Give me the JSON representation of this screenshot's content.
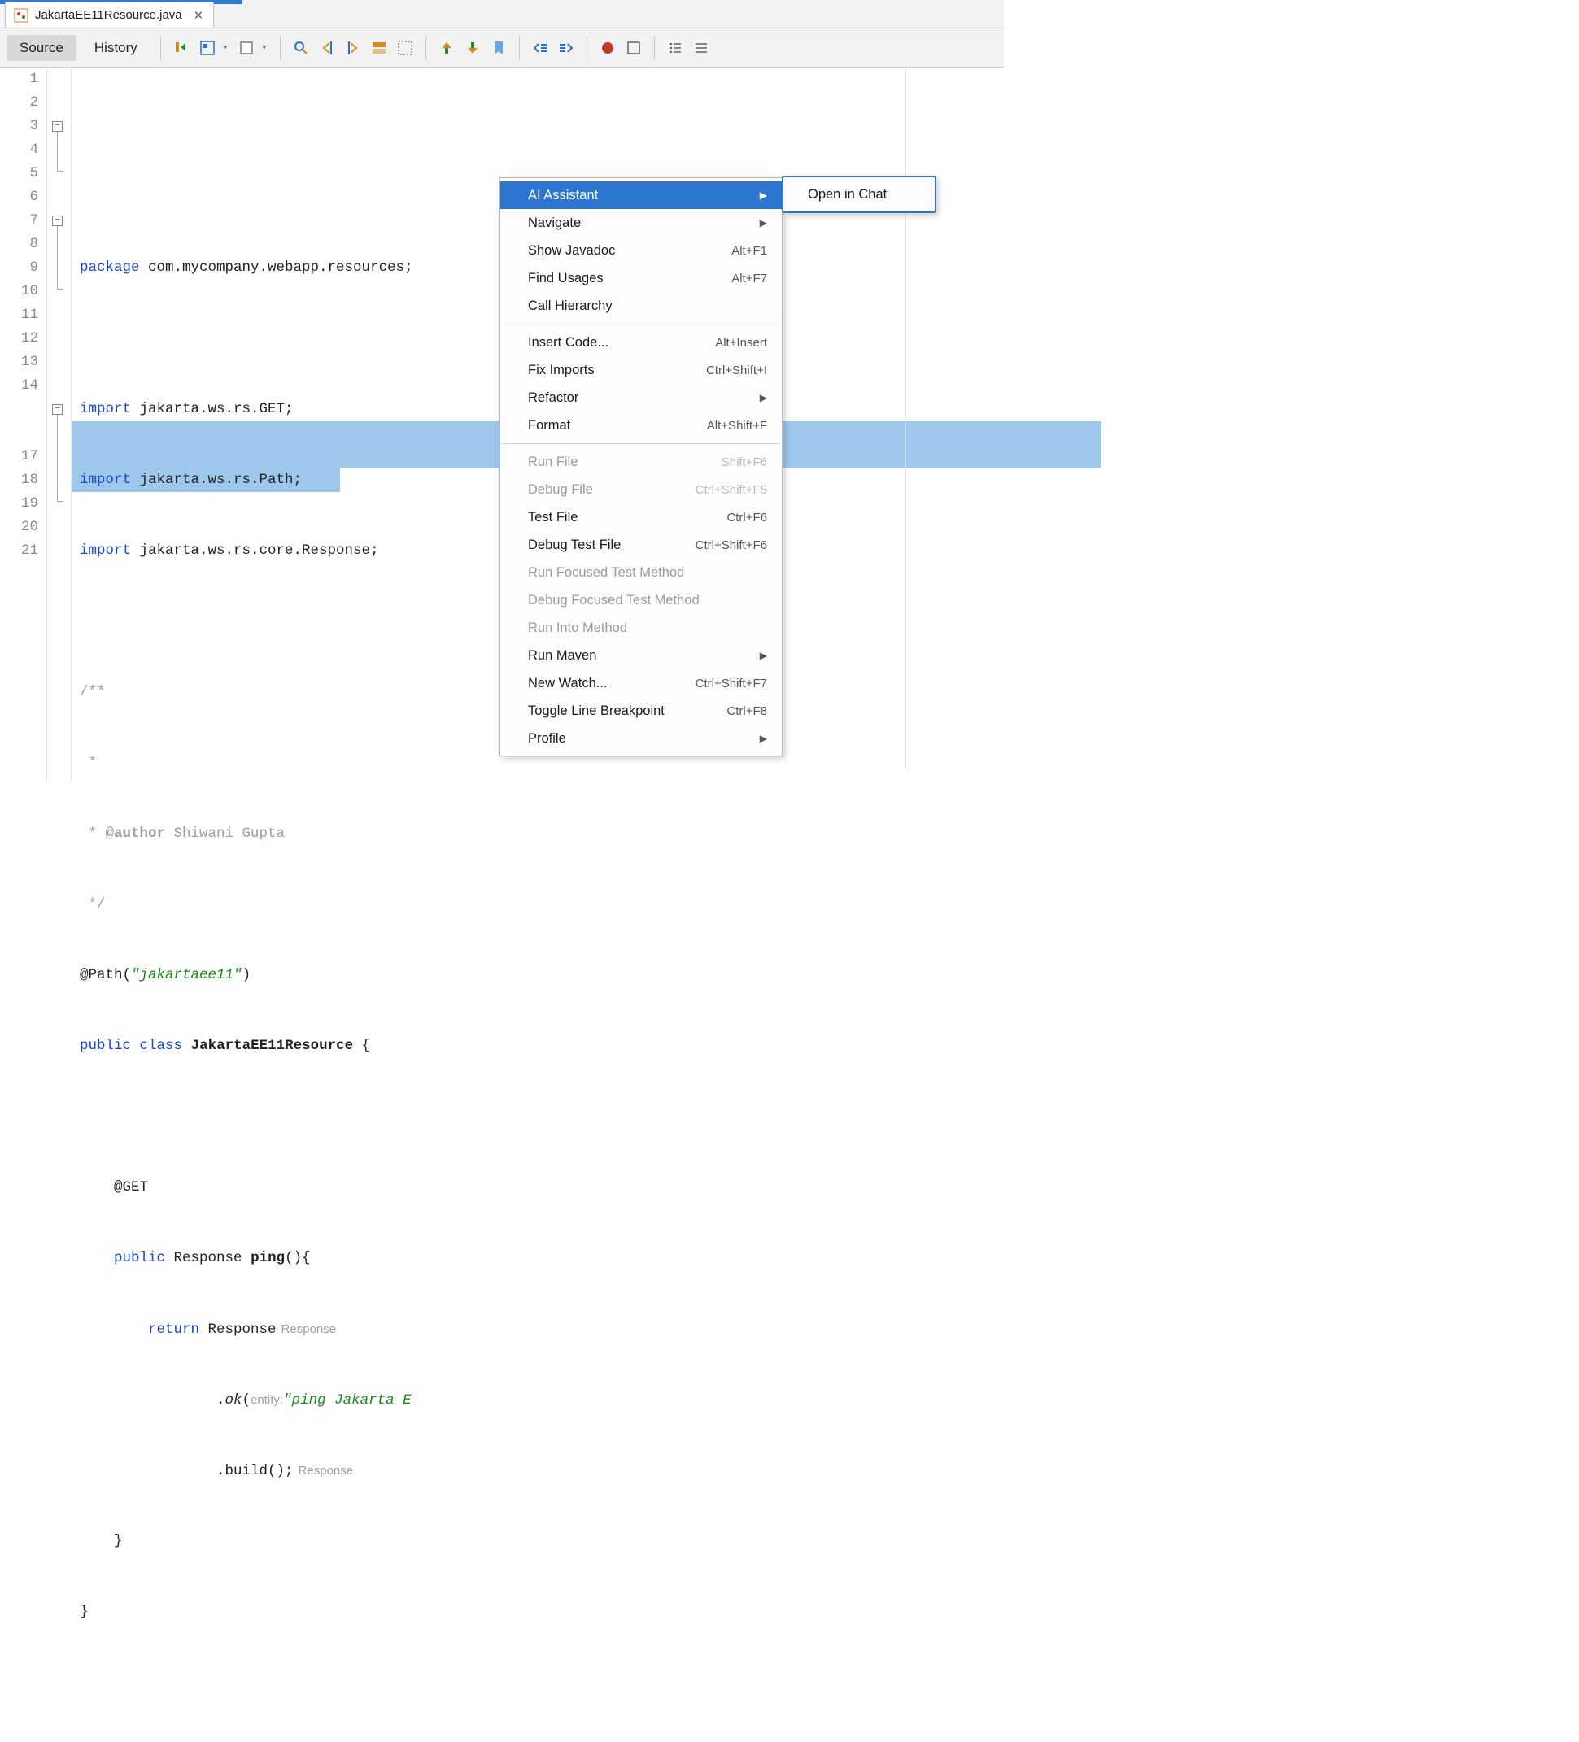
{
  "tab": {
    "filename": "JakartaEE11Resource.java"
  },
  "toolbar": {
    "view_tabs": {
      "source": "Source",
      "history": "History"
    }
  },
  "gutter_lines": [
    "1",
    "2",
    "3",
    "4",
    "5",
    "6",
    "7",
    "8",
    "9",
    "10",
    "11",
    "12",
    "13",
    "14",
    "",
    "",
    "17",
    "18",
    "19",
    "20",
    "21"
  ],
  "code": {
    "l1_kw": "package",
    "l1_rest": " com.mycompany.webapp.resources;",
    "l3_kw": "import",
    "l3_rest": " jakarta.ws.rs.GET;",
    "l4_kw": "import",
    "l4_rest": " jakarta.ws.rs.Path;",
    "l5_kw": "import",
    "l5_rest": " jakarta.ws.rs.core.Response;",
    "l7": "/**",
    "l8": " *",
    "l9_a": " * ",
    "l9_tag": "@author",
    "l9_b": " Shiwani Gupta",
    "l10": " */",
    "l11_a": "@Path",
    "l11_b": "(",
    "l11_str": "\"jakartaee11\"",
    "l11_c": ")",
    "l12_a": "public",
    "l12_b": " ",
    "l12_c": "class",
    "l12_d": " ",
    "l12_name": "JakartaEE11Resource",
    "l12_e": " {",
    "l14": "    @GET",
    "l15_a": "    ",
    "l15_kw": "public",
    "l15_b": " Response ",
    "l15_name": "ping",
    "l15_c": "(){",
    "l16_a": "        ",
    "l16_kw": "return",
    "l16_b": " Response",
    "l16_hint": "Response",
    "l17_a": "                .",
    "l17_ok": "ok",
    "l17_b": "(",
    "l17_label": "entity:",
    "l17_str": "\"ping Jakarta E",
    "l18_a": "                .build();",
    "l18_hint": "Response",
    "l19": "    }",
    "l20": "}"
  },
  "context_menu": {
    "items": [
      {
        "label": "AI Assistant",
        "shortcut": "",
        "arrow": true,
        "highlight": true,
        "disabled": false
      },
      {
        "label": "Navigate",
        "shortcut": "",
        "arrow": true,
        "highlight": false,
        "disabled": false
      },
      {
        "label": "Show Javadoc",
        "shortcut": "Alt+F1",
        "arrow": false,
        "highlight": false,
        "disabled": false
      },
      {
        "label": "Find Usages",
        "shortcut": "Alt+F7",
        "arrow": false,
        "highlight": false,
        "disabled": false
      },
      {
        "label": "Call Hierarchy",
        "shortcut": "",
        "arrow": false,
        "highlight": false,
        "disabled": false
      },
      "sep",
      {
        "label": "Insert Code...",
        "shortcut": "Alt+Insert",
        "arrow": false,
        "highlight": false,
        "disabled": false
      },
      {
        "label": "Fix Imports",
        "shortcut": "Ctrl+Shift+I",
        "arrow": false,
        "highlight": false,
        "disabled": false
      },
      {
        "label": "Refactor",
        "shortcut": "",
        "arrow": true,
        "highlight": false,
        "disabled": false
      },
      {
        "label": "Format",
        "shortcut": "Alt+Shift+F",
        "arrow": false,
        "highlight": false,
        "disabled": false
      },
      "sep",
      {
        "label": "Run File",
        "shortcut": "Shift+F6",
        "arrow": false,
        "highlight": false,
        "disabled": true
      },
      {
        "label": "Debug File",
        "shortcut": "Ctrl+Shift+F5",
        "arrow": false,
        "highlight": false,
        "disabled": true
      },
      {
        "label": "Test File",
        "shortcut": "Ctrl+F6",
        "arrow": false,
        "highlight": false,
        "disabled": false
      },
      {
        "label": "Debug Test File",
        "shortcut": "Ctrl+Shift+F6",
        "arrow": false,
        "highlight": false,
        "disabled": false
      },
      {
        "label": "Run Focused Test Method",
        "shortcut": "",
        "arrow": false,
        "highlight": false,
        "disabled": true
      },
      {
        "label": "Debug Focused Test Method",
        "shortcut": "",
        "arrow": false,
        "highlight": false,
        "disabled": true
      },
      {
        "label": "Run Into Method",
        "shortcut": "",
        "arrow": false,
        "highlight": false,
        "disabled": true
      },
      {
        "label": "Run Maven",
        "shortcut": "",
        "arrow": true,
        "highlight": false,
        "disabled": false
      },
      {
        "label": "New Watch...",
        "shortcut": "Ctrl+Shift+F7",
        "arrow": false,
        "highlight": false,
        "disabled": false
      },
      {
        "label": "Toggle Line Breakpoint",
        "shortcut": "Ctrl+F8",
        "arrow": false,
        "highlight": false,
        "disabled": false
      },
      {
        "label": "Profile",
        "shortcut": "",
        "arrow": true,
        "highlight": false,
        "disabled": false
      }
    ]
  },
  "submenu": {
    "items": [
      {
        "label": "Open in Chat"
      }
    ]
  }
}
